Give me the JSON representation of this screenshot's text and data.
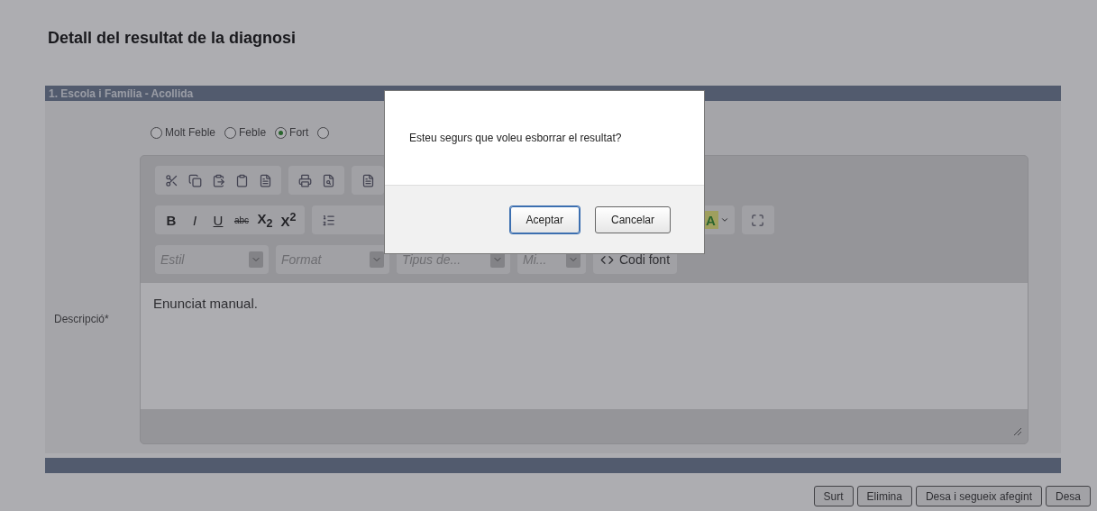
{
  "page": {
    "title": "Detall del resultat de la diagnosi"
  },
  "section": {
    "title": "1. Escola i Família - Acollida"
  },
  "rating": [
    {
      "label": "Molt Feble",
      "selected": false
    },
    {
      "label": "Feble",
      "selected": false
    },
    {
      "label": "Fort",
      "selected": true
    },
    {
      "selected": false
    }
  ],
  "editor": {
    "label": "Descripció*",
    "format_buttons": [
      {
        "label": "B",
        "kind": "bold"
      },
      {
        "label": "I",
        "kind": "italic"
      },
      {
        "label": "U",
        "kind": "underline"
      },
      {
        "label": "abc",
        "kind": "strike"
      },
      {
        "label": "X$_{2}$",
        "kind": "script"
      },
      {
        "label": "X$^{2}$",
        "kind": "script"
      }
    ],
    "color_button": {
      "label": "A"
    },
    "combos": [
      {
        "placeholder": "Estil"
      },
      {
        "placeholder": "Format"
      },
      {
        "placeholder": "Tipus de..."
      },
      {
        "placeholder": "Mi..."
      }
    ],
    "source_button": "Codi font",
    "content": "Enunciat manual."
  },
  "footer_buttons": [
    "Surt",
    "Elimina",
    "Desa i segueix afegint",
    "Desa"
  ],
  "dialog": {
    "message": "Esteu segurs que voleu esborrar el resultat?",
    "buttons": [
      {
        "label": "Aceptar",
        "focused": true
      },
      {
        "label": "Cancelar",
        "focused": false
      }
    ]
  }
}
